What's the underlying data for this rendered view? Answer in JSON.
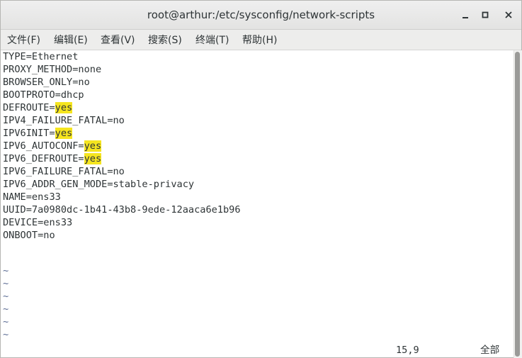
{
  "window": {
    "title": "root@arthur:/etc/sysconfig/network-scripts",
    "buttons": [
      {
        "icon": "minimize-icon"
      },
      {
        "icon": "maximize-icon"
      },
      {
        "icon": "close-icon"
      }
    ]
  },
  "menubar": {
    "items": [
      "文件(F)",
      "编辑(E)",
      "查看(V)",
      "搜索(S)",
      "终端(T)",
      "帮助(H)"
    ]
  },
  "editor": {
    "lines": [
      {
        "key": "TYPE=",
        "value": "Ethernet",
        "highlight": false
      },
      {
        "key": "PROXY_METHOD=",
        "value": "none",
        "highlight": false
      },
      {
        "key": "BROWSER_ONLY=",
        "value": "no",
        "highlight": false
      },
      {
        "key": "BOOTPROTO=",
        "value": "dhcp",
        "highlight": false
      },
      {
        "key": "DEFROUTE=",
        "value": "yes",
        "highlight": true
      },
      {
        "key": "IPV4_FAILURE_FATAL=",
        "value": "no",
        "highlight": false
      },
      {
        "key": "IPV6INIT=",
        "value": "yes",
        "highlight": true
      },
      {
        "key": "IPV6_AUTOCONF=",
        "value": "yes",
        "highlight": true
      },
      {
        "key": "IPV6_DEFROUTE=",
        "value": "yes",
        "highlight": true
      },
      {
        "key": "IPV6_FAILURE_FATAL=",
        "value": "no",
        "highlight": false
      },
      {
        "key": "IPV6_ADDR_GEN_MODE=",
        "value": "stable-privacy",
        "highlight": false
      },
      {
        "key": "NAME=",
        "value": "ens33",
        "highlight": false
      },
      {
        "key": "UUID=",
        "value": "7a0980dc-1b41-43b8-9ede-12aaca6e1b96",
        "highlight": false
      },
      {
        "key": "DEVICE=",
        "value": "ens33",
        "highlight": false
      },
      {
        "key": "ONBOOT=",
        "value": "no",
        "highlight": false
      }
    ],
    "empty_line_marker": "~",
    "empty_line_count": 6,
    "highlight_color": "#f5e51f",
    "tilde_color": "#5b6b93"
  },
  "status": {
    "position": "15,9",
    "scroll_percent": "全部"
  }
}
